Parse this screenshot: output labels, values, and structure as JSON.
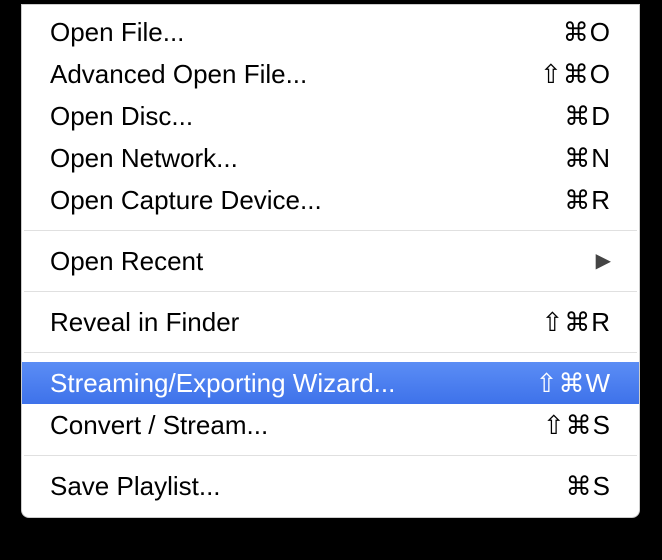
{
  "menu": {
    "groups": [
      [
        {
          "label": "Open File...",
          "shortcut": "⌘O",
          "submenu": false,
          "highlighted": false
        },
        {
          "label": "Advanced Open File...",
          "shortcut": "⇧⌘O",
          "submenu": false,
          "highlighted": false
        },
        {
          "label": "Open Disc...",
          "shortcut": "⌘D",
          "submenu": false,
          "highlighted": false
        },
        {
          "label": "Open Network...",
          "shortcut": "⌘N",
          "submenu": false,
          "highlighted": false
        },
        {
          "label": "Open Capture Device...",
          "shortcut": "⌘R",
          "submenu": false,
          "highlighted": false
        }
      ],
      [
        {
          "label": "Open Recent",
          "shortcut": "",
          "submenu": true,
          "highlighted": false
        }
      ],
      [
        {
          "label": "Reveal in Finder",
          "shortcut": "⇧⌘R",
          "submenu": false,
          "highlighted": false
        }
      ],
      [
        {
          "label": "Streaming/Exporting Wizard...",
          "shortcut": "⇧⌘W",
          "submenu": false,
          "highlighted": true
        },
        {
          "label": "Convert / Stream...",
          "shortcut": "⇧⌘S",
          "submenu": false,
          "highlighted": false
        }
      ],
      [
        {
          "label": "Save Playlist...",
          "shortcut": "⌘S",
          "submenu": false,
          "highlighted": false
        }
      ]
    ]
  }
}
